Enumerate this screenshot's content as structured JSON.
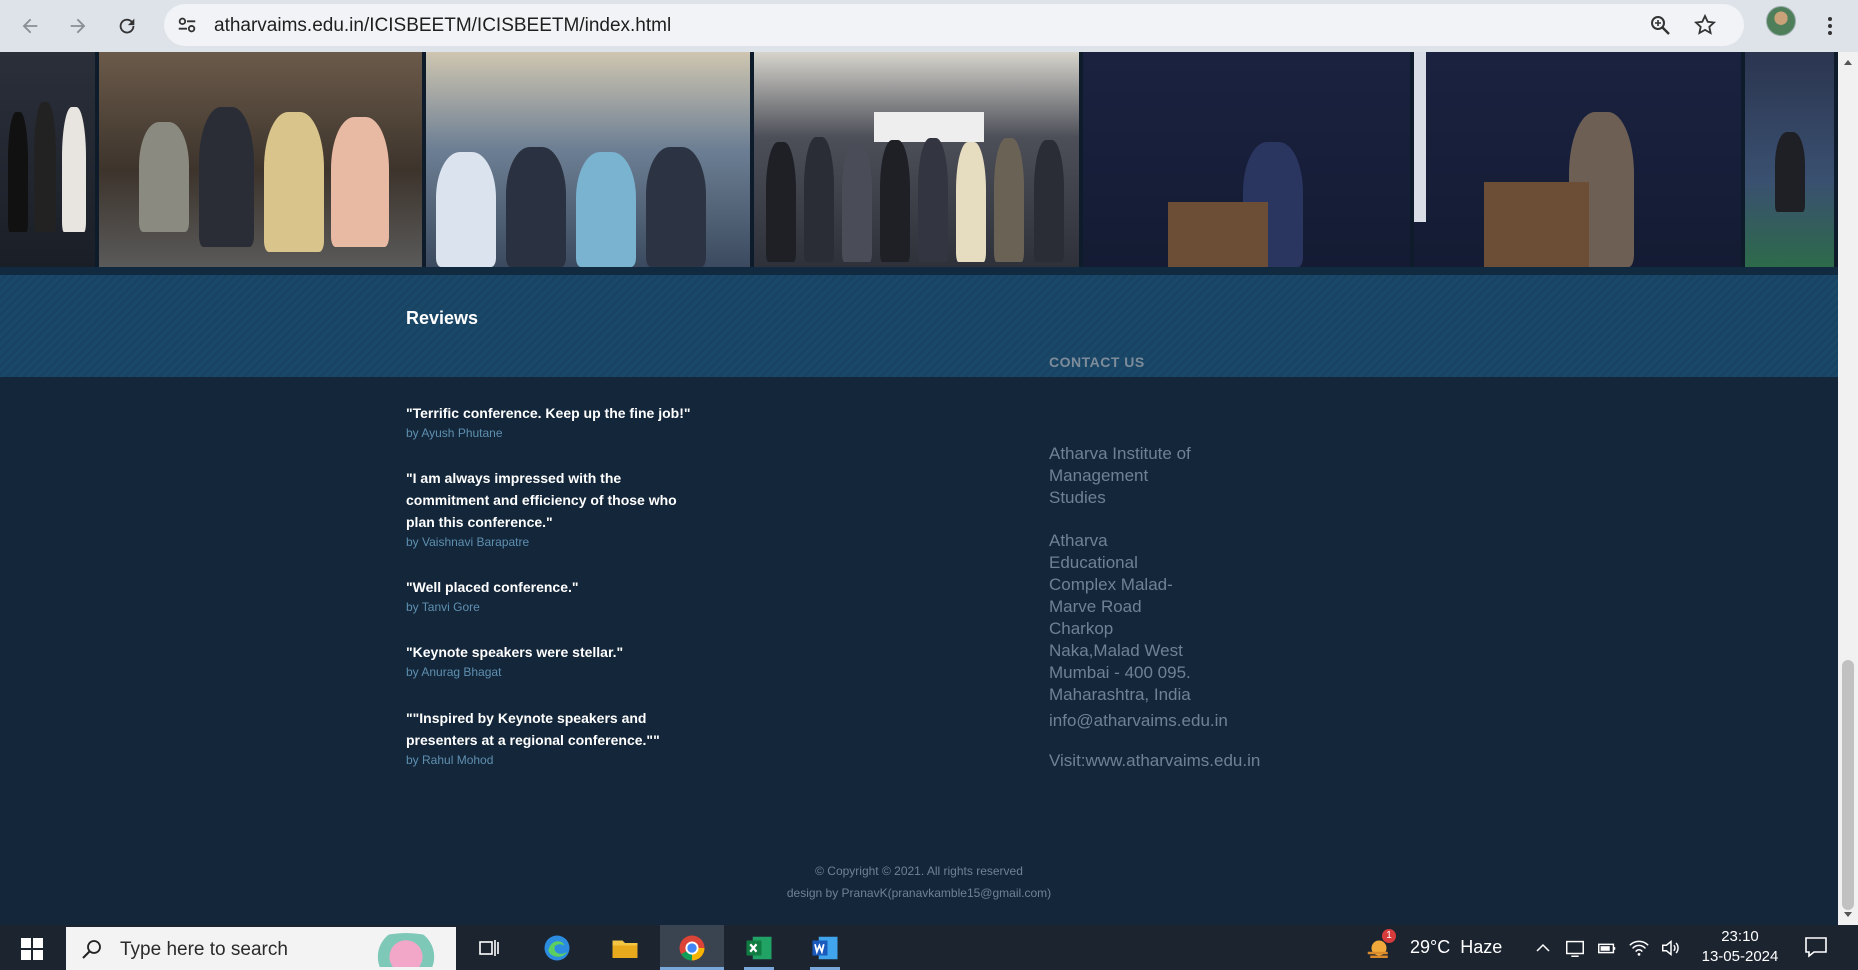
{
  "browser": {
    "url": "atharvaims.edu.in/ICISBEETM/ICISBEETM/index.html",
    "icons": [
      "back-arrow-icon",
      "forward-arrow-icon",
      "reload-icon",
      "site-settings-icon",
      "zoom-icon",
      "bookmark-star-icon",
      "profile-avatar",
      "menu-dots-icon"
    ]
  },
  "reviews": {
    "title": "Reviews",
    "items": [
      {
        "quote": "\"Terrific conference. Keep up the fine job!\"",
        "author": "by Ayush Phutane"
      },
      {
        "quote": "\"I am always impressed with the commitment and efficiency of those who plan this conference.\"",
        "author": "by Vaishnavi Barapatre"
      },
      {
        "quote": "\"Well placed conference.\"",
        "author": "by Tanvi Gore"
      },
      {
        "quote": "\"Keynote speakers were stellar.\"",
        "author": "by Anurag Bhagat"
      },
      {
        "quote": "\"\"Inspired by Keynote speakers and presenters at a regional conference.\"\"",
        "author": "by Rahul Mohod"
      }
    ]
  },
  "contact": {
    "title": "CONTACT US",
    "institute": [
      "Atharva Institute of",
      "Management",
      "Studies"
    ],
    "address": [
      "Atharva",
      "Educational",
      "Complex Malad-",
      "Marve Road",
      "Charkop",
      "Naka,Malad West",
      "Mumbai - 400 095.",
      "Maharashtra, India"
    ],
    "email": "info@atharvaims.edu.in",
    "website": "Visit:www.atharvaims.edu.in"
  },
  "copyright": {
    "line1": "© Copyright © 2021. All rights reserved",
    "line2": "design by PranavK(pranavkamble15@gmail.com)"
  },
  "taskbar": {
    "search_placeholder": "Type here to search",
    "weather": "29°C  Haze",
    "weather_badge": "1",
    "time": "23:10",
    "date": "13-05-2024"
  },
  "colors": {
    "footer_bg": "#14273a",
    "band_bg": "#1a4868",
    "review_author": "#5e8fb0",
    "contact_text": "#6f8294"
  }
}
